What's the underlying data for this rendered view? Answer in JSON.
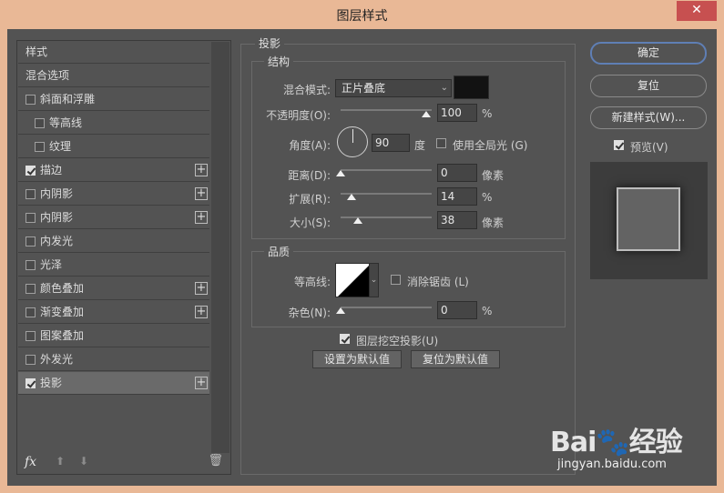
{
  "window": {
    "title": "图层样式",
    "close": "✕"
  },
  "sidebar": {
    "items": [
      {
        "label": "样式",
        "checkbox": false,
        "checked": false,
        "plus": false,
        "indent": 0
      },
      {
        "label": "混合选项",
        "checkbox": false,
        "checked": false,
        "plus": false,
        "indent": 0
      },
      {
        "label": "斜面和浮雕",
        "checkbox": true,
        "checked": false,
        "plus": false,
        "indent": 0
      },
      {
        "label": "等高线",
        "checkbox": true,
        "checked": false,
        "plus": false,
        "indent": 1
      },
      {
        "label": "纹理",
        "checkbox": true,
        "checked": false,
        "plus": false,
        "indent": 1
      },
      {
        "label": "描边",
        "checkbox": true,
        "checked": true,
        "plus": true,
        "indent": 0
      },
      {
        "label": "内阴影",
        "checkbox": true,
        "checked": false,
        "plus": true,
        "indent": 0
      },
      {
        "label": "内阴影",
        "checkbox": true,
        "checked": false,
        "plus": true,
        "indent": 0
      },
      {
        "label": "内发光",
        "checkbox": true,
        "checked": false,
        "plus": false,
        "indent": 0
      },
      {
        "label": "光泽",
        "checkbox": true,
        "checked": false,
        "plus": false,
        "indent": 0
      },
      {
        "label": "颜色叠加",
        "checkbox": true,
        "checked": false,
        "plus": true,
        "indent": 0
      },
      {
        "label": "渐变叠加",
        "checkbox": true,
        "checked": false,
        "plus": true,
        "indent": 0
      },
      {
        "label": "图案叠加",
        "checkbox": true,
        "checked": false,
        "plus": false,
        "indent": 0
      },
      {
        "label": "外发光",
        "checkbox": true,
        "checked": false,
        "plus": false,
        "indent": 0
      },
      {
        "label": "投影",
        "checkbox": true,
        "checked": true,
        "plus": true,
        "indent": 0,
        "selected": true
      }
    ],
    "plus_symbol": "+",
    "fx": "fx",
    "up_arrow": "⬆",
    "down_arrow": "⬇",
    "trash": "🗑"
  },
  "shadow": {
    "group_title": "投影",
    "structure_title": "结构",
    "blend_mode_label": "混合模式:",
    "blend_mode_value": "正片叠底",
    "blend_color": "#121212",
    "opacity_label": "不透明度(O):",
    "opacity_value": "100",
    "opacity_unit": "%",
    "angle_label": "角度(A):",
    "angle_value": "90",
    "angle_unit": "度",
    "global_light_label": "使用全局光 (G)",
    "distance_label": "距离(D):",
    "distance_value": "0",
    "distance_unit": "像素",
    "spread_label": "扩展(R):",
    "spread_value": "14",
    "spread_unit": "%",
    "size_label": "大小(S):",
    "size_value": "38",
    "size_unit": "像素",
    "quality_title": "品质",
    "contour_label": "等高线:",
    "antialias_label": "消除锯齿 (L)",
    "noise_label": "杂色(N):",
    "noise_value": "0",
    "noise_unit": "%",
    "knockout_label": "图层挖空投影(U)",
    "set_default_label": "设置为默认值",
    "reset_default_label": "复位为默认值"
  },
  "actions": {
    "ok_label": "确定",
    "reset_label": "复位",
    "new_style_label": "新建样式(W)...",
    "preview_label": "预览(V)"
  },
  "watermark": {
    "main": "Bai🐾经验",
    "sub": "jingyan.baidu.com"
  }
}
